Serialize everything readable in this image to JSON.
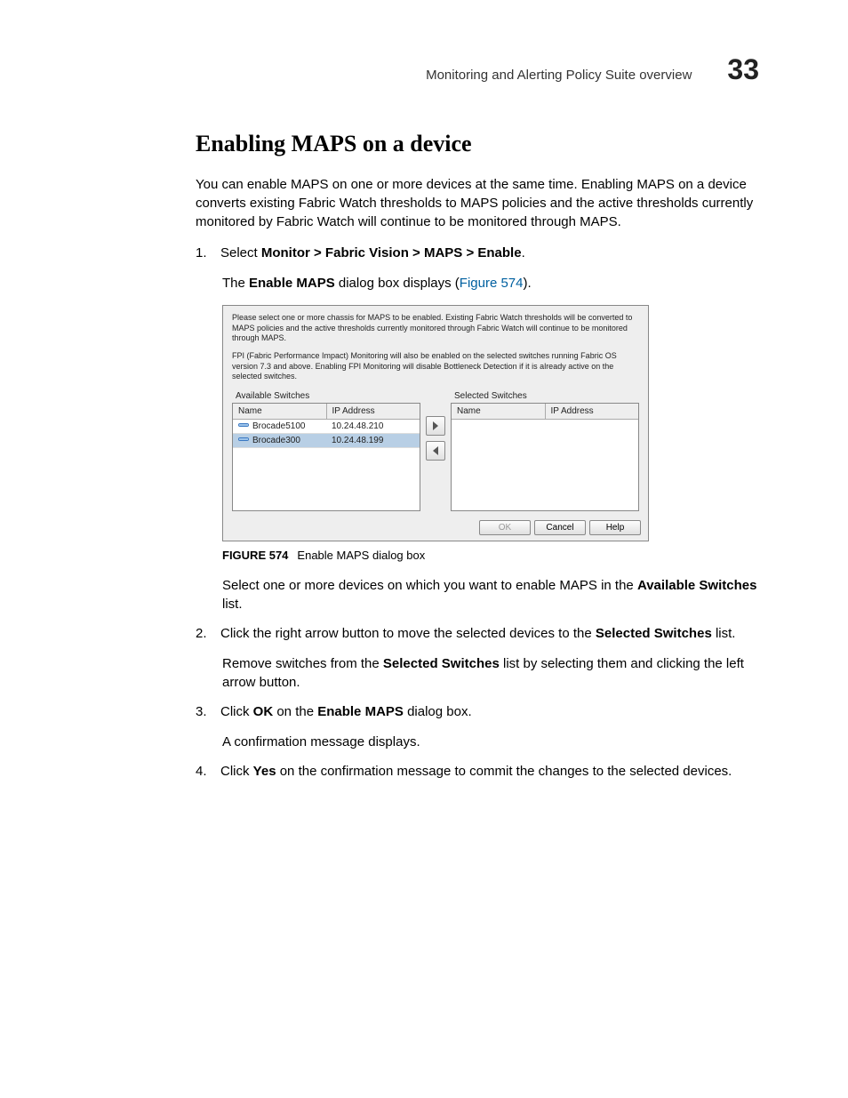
{
  "header": {
    "title": "Monitoring and Alerting Policy Suite overview",
    "chapter": "33"
  },
  "section_title": "Enabling MAPS on a device",
  "intro": "You can enable MAPS on one or more devices at the same time. Enabling MAPS on a device converts existing Fabric Watch thresholds to MAPS policies and the active thresholds currently monitored by Fabric Watch will continue to be monitored through MAPS.",
  "step1": {
    "num": "1.",
    "prefix": "Select ",
    "path": "Monitor > Fabric Vision > MAPS > Enable",
    "suffix": ".",
    "result_a": "The ",
    "result_b": "Enable MAPS",
    "result_c": " dialog box displays (",
    "link": "Figure 574",
    "result_d": ")."
  },
  "dialog": {
    "para1": "Please select one or more chassis for MAPS to be enabled. Existing Fabric Watch thresholds will be converted to MAPS policies and the active thresholds currently monitored through Fabric Watch will continue to be monitored through MAPS.",
    "para2": "FPI (Fabric Performance Impact) Monitoring will also be enabled on the selected switches running Fabric OS version 7.3 and above. Enabling FPI Monitoring will disable Bottleneck Detection if it is already active on the selected switches.",
    "available_title": "Available Switches",
    "selected_title": "Selected Switches",
    "col_name": "Name",
    "col_ip": "IP Address",
    "rows": [
      {
        "name": "Brocade5100",
        "ip": "10.24.48.210"
      },
      {
        "name": "Brocade300",
        "ip": "10.24.48.199"
      }
    ],
    "buttons": {
      "ok": "OK",
      "cancel": "Cancel",
      "help": "Help"
    }
  },
  "figure": {
    "label": "FIGURE 574",
    "caption": "Enable MAPS dialog box"
  },
  "after_figure_a": "Select one or more devices on which you want to enable MAPS in the ",
  "after_figure_b": "Available Switches",
  "after_figure_c": " list.",
  "step2": {
    "num": "2.",
    "a": "Click the right arrow button to move the selected devices to the ",
    "b": "Selected Switches",
    "c": " list.",
    "remove_a": "Remove switches from the ",
    "remove_b": "Selected Switches",
    "remove_c": " list by selecting them and clicking the left arrow button."
  },
  "step3": {
    "num": "3.",
    "a": "Click ",
    "b": "OK",
    "c": " on the ",
    "d": "Enable MAPS",
    "e": " dialog box.",
    "result": "A confirmation message displays."
  },
  "step4": {
    "num": "4.",
    "a": "Click ",
    "b": "Yes",
    "c": " on the confirmation message to commit the changes to the selected devices."
  }
}
